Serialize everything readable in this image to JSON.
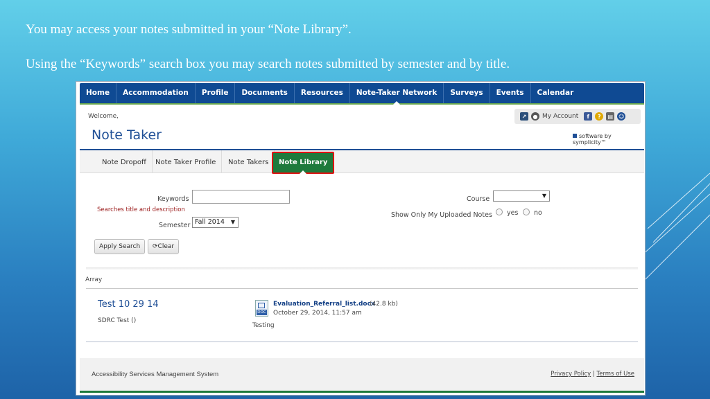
{
  "slide": {
    "caption_1": "You may access your notes submitted in your “Note Library”.",
    "caption_2": "Using the “Keywords” search box you may search notes submitted by semester and by title."
  },
  "topnav": {
    "items": [
      "Home",
      "Accommodation",
      "Profile",
      "Documents",
      "Resources",
      "Note-Taker Network",
      "Surveys",
      "Events",
      "Calendar"
    ],
    "active": "Note-Taker Network"
  },
  "header": {
    "welcome": "Welcome,",
    "app_title": "Note Taker",
    "my_account": "My Account",
    "vendor": "software by symplicity™"
  },
  "subnav": {
    "items": [
      "Note Dropoff",
      "Note Taker Profile",
      "Note Takers",
      "Note Library"
    ],
    "active": "Note Library"
  },
  "search": {
    "keywords_label": "Keywords",
    "keywords_value": "",
    "keywords_hint": "Searches title and description",
    "semester_label": "Semester",
    "semester_value": "Fall 2014",
    "course_label": "Course",
    "course_value": "",
    "uploaded_label": "Show Only My Uploaded Notes",
    "option_yes": "yes",
    "option_no": "no",
    "apply_label": "Apply Search",
    "clear_label": "Clear"
  },
  "results": {
    "array_label": "Array",
    "note": {
      "title": "Test 10 29 14",
      "course": "SDRC Test ()",
      "file_name": "Evaluation_Referral_list.docx",
      "file_size": "(42.8 kb)",
      "file_date": "October 29, 2014, 11:57 am",
      "file_type": "DOC",
      "description": "Testing"
    }
  },
  "footer": {
    "system_name": "Accessibility Services Management System",
    "privacy": "Privacy Policy",
    "separator": "|",
    "terms": "Terms of Use"
  },
  "colors": {
    "nav_blue": "#0f4a93",
    "active_green": "#1e7a3c",
    "highlight_red": "#dd1111",
    "title_blue": "#1f4f96"
  }
}
